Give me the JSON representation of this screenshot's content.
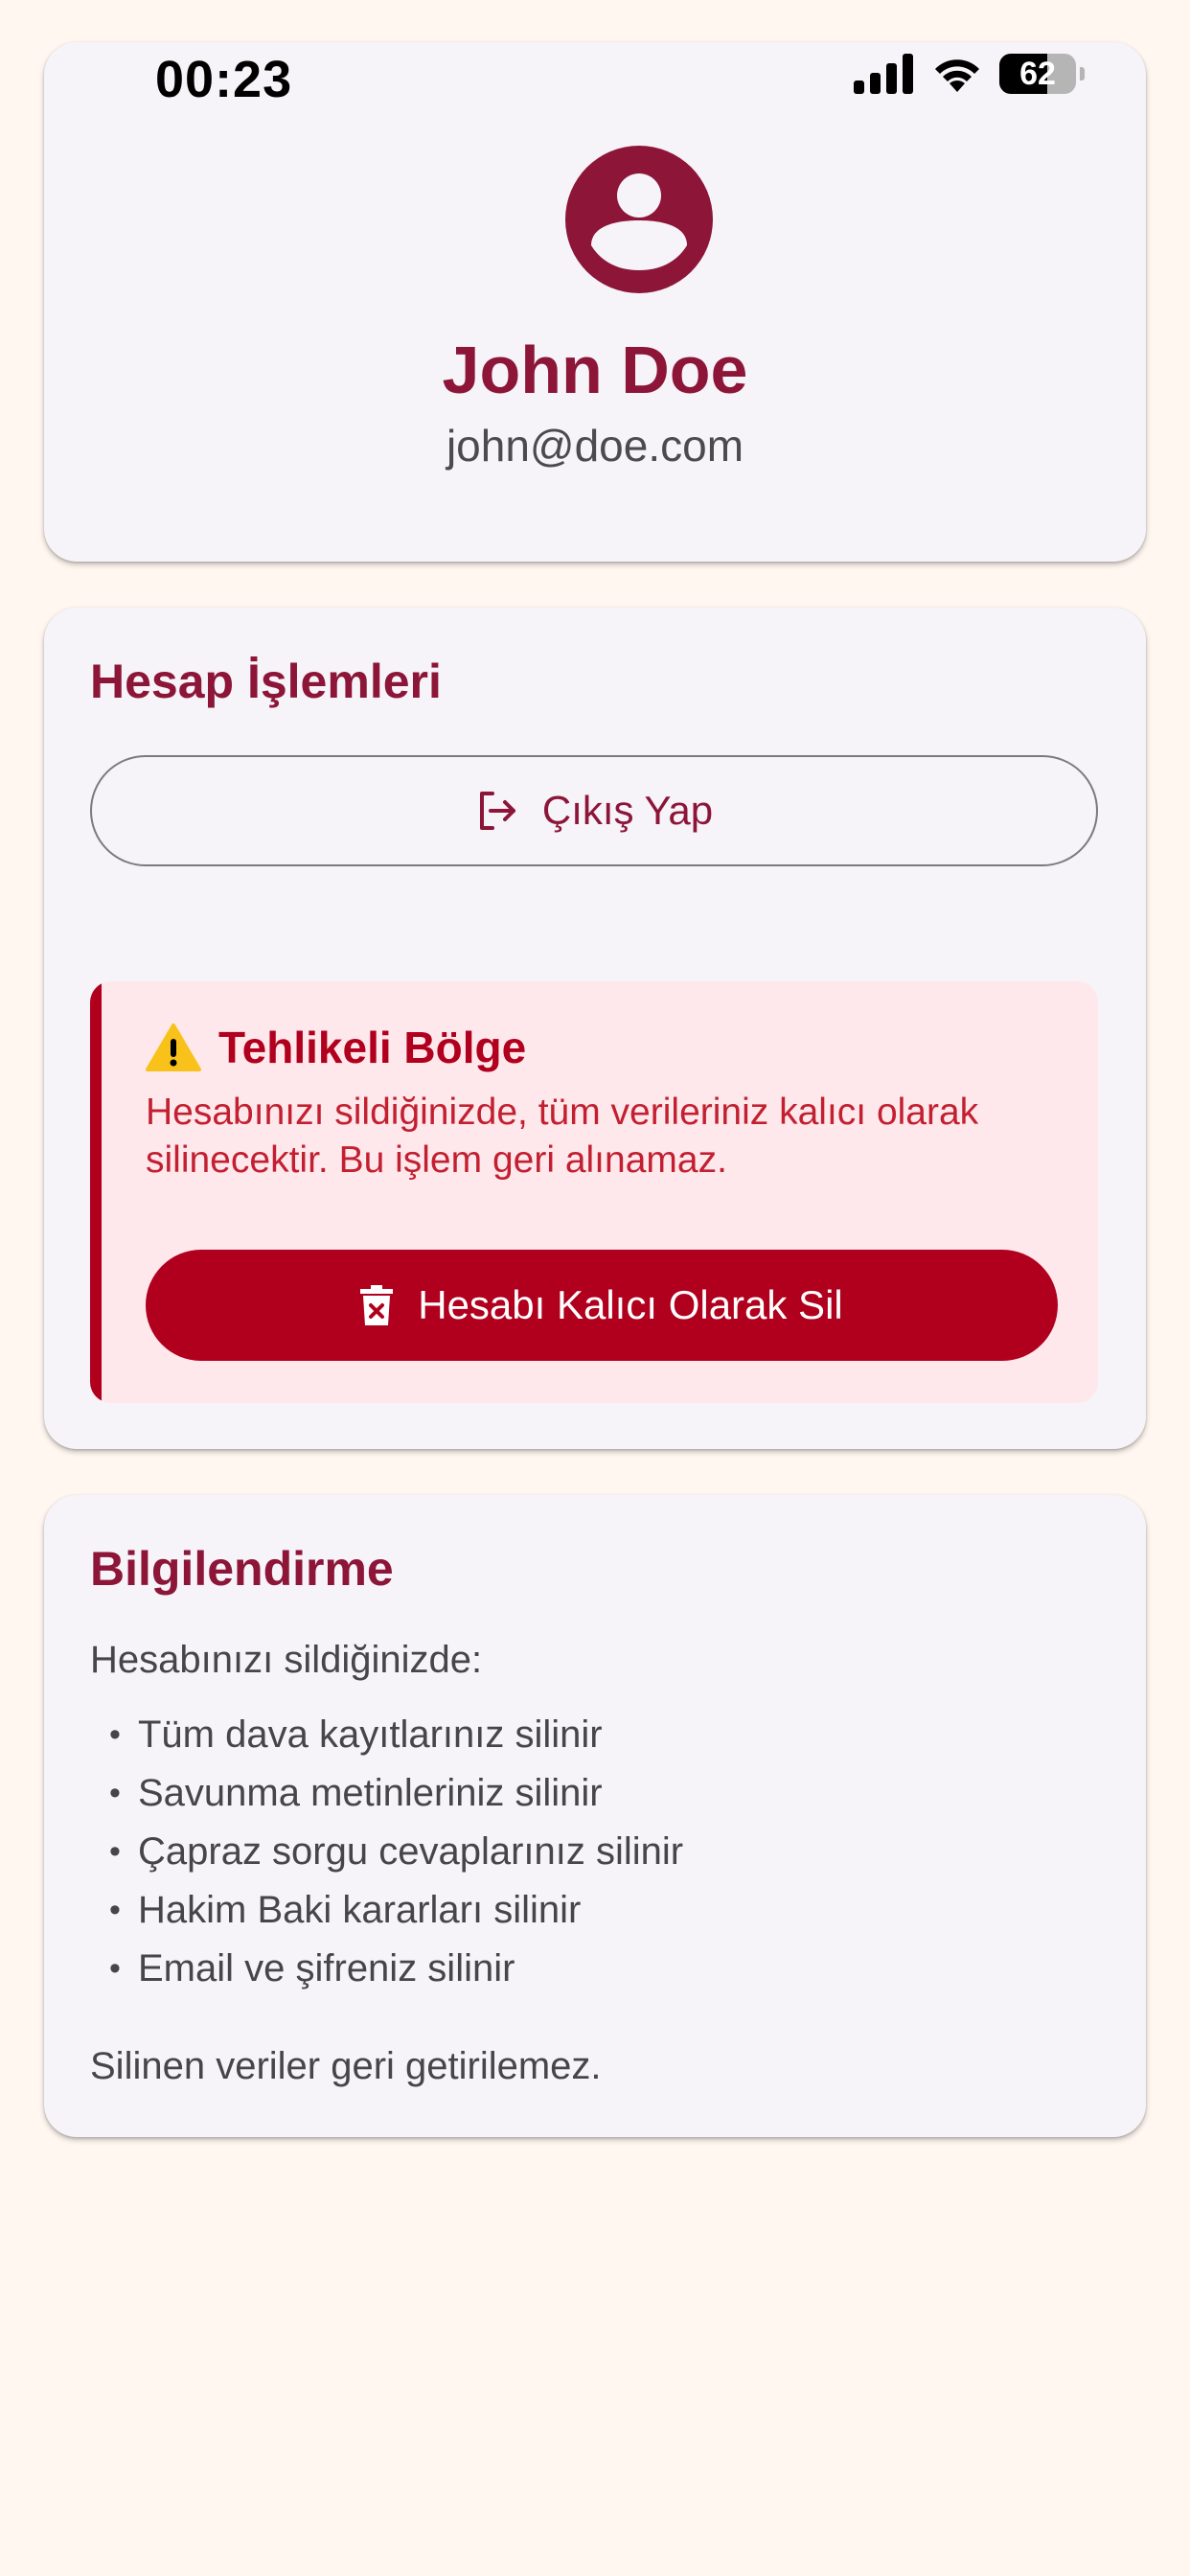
{
  "status_bar": {
    "time": "00:23",
    "battery": "62",
    "battery_level": 0.62
  },
  "profile": {
    "name": "John Doe",
    "email": "john@doe.com"
  },
  "account": {
    "title": "Hesap İşlemleri",
    "logout_label": "Çıkış Yap",
    "danger_zone": {
      "icon": "⚠️",
      "title": "Tehlikeli Bölge",
      "description": "Hesabınızı sildiğinizde, tüm verileriniz kalıcı olarak silinecektir. Bu işlem geri alınamaz.",
      "delete_label": "Hesabı Kalıcı Olarak Sil"
    }
  },
  "info": {
    "title": "Bilgilendirme",
    "intro": "Hesabınızı sildiğinizde:",
    "items": [
      "Tüm dava kayıtlarınız silinir",
      "Savunma metinleriniz silinir",
      "Çapraz sorgu cevaplarınız silinir",
      "Hakim Baki kararları silinir",
      "Email ve şifreniz silinir"
    ],
    "outro": "Silinen veriler geri getirilemez."
  },
  "colors": {
    "background": "#FFF7F0",
    "card": "#F6F3F9",
    "accent": "#8C1538",
    "danger": "#B0001E",
    "danger_bg": "#FFE8EC"
  },
  "icons": {
    "avatar": "account-circle-icon",
    "logout": "logout-icon",
    "warning": "warning-icon",
    "delete": "trash-icon"
  }
}
